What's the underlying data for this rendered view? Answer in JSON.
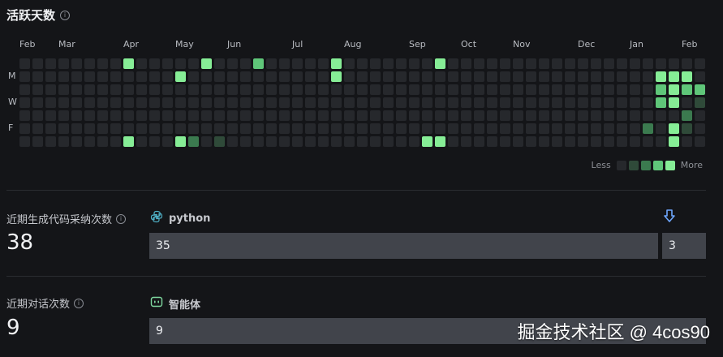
{
  "header": {
    "title": "活跃天数",
    "info_icon": "info-icon"
  },
  "heatmap": {
    "months": [
      "Feb",
      "Mar",
      "Apr",
      "May",
      "Jun",
      "Jul",
      "Aug",
      "Sep",
      "Oct",
      "Nov",
      "Dec",
      "Jan",
      "Feb"
    ],
    "month_weeks": [
      0,
      3,
      8,
      12,
      16,
      21,
      25,
      30,
      34,
      38,
      43,
      47,
      51
    ],
    "weekdays": [
      "M",
      "W",
      "F"
    ],
    "weekday_rows": [
      1,
      3,
      5
    ],
    "weeks": 53,
    "active": [
      [
        8,
        0,
        4
      ],
      [
        8,
        6,
        4
      ],
      [
        12,
        1,
        4
      ],
      [
        12,
        6,
        4
      ],
      [
        13,
        6,
        2
      ],
      [
        14,
        0,
        4
      ],
      [
        15,
        6,
        1
      ],
      [
        18,
        0,
        3
      ],
      [
        24,
        0,
        4
      ],
      [
        24,
        1,
        4
      ],
      [
        31,
        6,
        4
      ],
      [
        32,
        0,
        4
      ],
      [
        32,
        6,
        4
      ],
      [
        48,
        5,
        2
      ],
      [
        49,
        1,
        4
      ],
      [
        49,
        2,
        3
      ],
      [
        49,
        3,
        3
      ],
      [
        50,
        1,
        4
      ],
      [
        50,
        2,
        4
      ],
      [
        50,
        3,
        4
      ],
      [
        50,
        5,
        4
      ],
      [
        50,
        6,
        4
      ],
      [
        51,
        1,
        4
      ],
      [
        51,
        2,
        3
      ],
      [
        51,
        4,
        2
      ],
      [
        51,
        5,
        1
      ],
      [
        52,
        2,
        3
      ],
      [
        52,
        3,
        1
      ]
    ],
    "legend": {
      "less": "Less",
      "more": "More",
      "levels": [
        0,
        1,
        2,
        3,
        4
      ]
    }
  },
  "adoption": {
    "label": "近期生成代码采纳次数",
    "value": "38",
    "language": "python",
    "language_icon": "python-icon",
    "bars": [
      {
        "value": "35"
      },
      {
        "value": "3"
      }
    ],
    "arrow_icon": "arrow-down-icon"
  },
  "dialogs": {
    "label": "近期对话次数",
    "value": "9",
    "agent": "智能体",
    "agent_icon": "robot-icon",
    "bars": [
      {
        "value": "9"
      }
    ]
  },
  "watermark": "掘金技术社区 @ 4cos90",
  "colors": {
    "accent": "#86ed96",
    "bar": "#41444b",
    "background": "#141518"
  }
}
